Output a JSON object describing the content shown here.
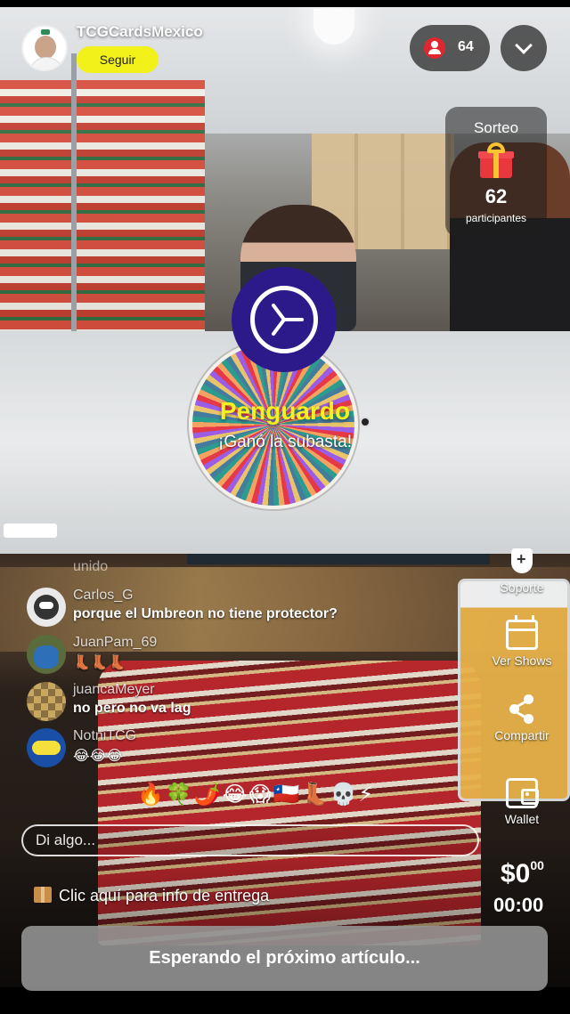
{
  "header": {
    "channel_name": "TCGCardsMexico",
    "follow_label": "Seguir",
    "viewer_count": "64"
  },
  "giveaway": {
    "title": "Sorteo",
    "participants_count": "62",
    "participants_label": "participantes"
  },
  "auction_result": {
    "winner": "Penguardo",
    "message": "¡Ganó la subasta!"
  },
  "chat": {
    "faded_line": "unido",
    "messages": [
      {
        "user": "Carlos_G",
        "text": "porque el Umbreon no tiene protector?",
        "avatar": "carlos-avatar"
      },
      {
        "user": "JuanPam_69",
        "text": "👢👢👢",
        "avatar": "juanpam-avatar"
      },
      {
        "user": "juancaMeyer",
        "text": "no pero no va lag",
        "avatar": "juancameyer-avatar"
      },
      {
        "user": "NotniTCG",
        "text": "😂😂😂",
        "avatar": "notnitcg-avatar"
      }
    ],
    "quick_reactions": "🔥🍀🌶️😂😱🇨🇱👢💀⚡",
    "input_placeholder": "Di algo..."
  },
  "side_actions": {
    "support_label": "Soporte",
    "shows_label": "Ver Shows",
    "share_label": "Compartir",
    "wallet_label": "Wallet"
  },
  "delivery_info": "Clic aquí para info de entrega",
  "price": {
    "amount": "$0",
    "cents": "00",
    "timer": "00:00"
  },
  "main_action": "Esperando el próximo artículo...",
  "colors": {
    "follow_button": "#f2f21a",
    "winner_text": "#f5f01f",
    "timer_badge": "#2c1a8a",
    "live_dot": "#e0262e"
  },
  "icons": [
    "person-icon",
    "chevron-down-icon",
    "gift-icon",
    "timer-icon",
    "support-icon",
    "calendar-icon",
    "share-icon",
    "wallet-icon",
    "package-icon"
  ]
}
